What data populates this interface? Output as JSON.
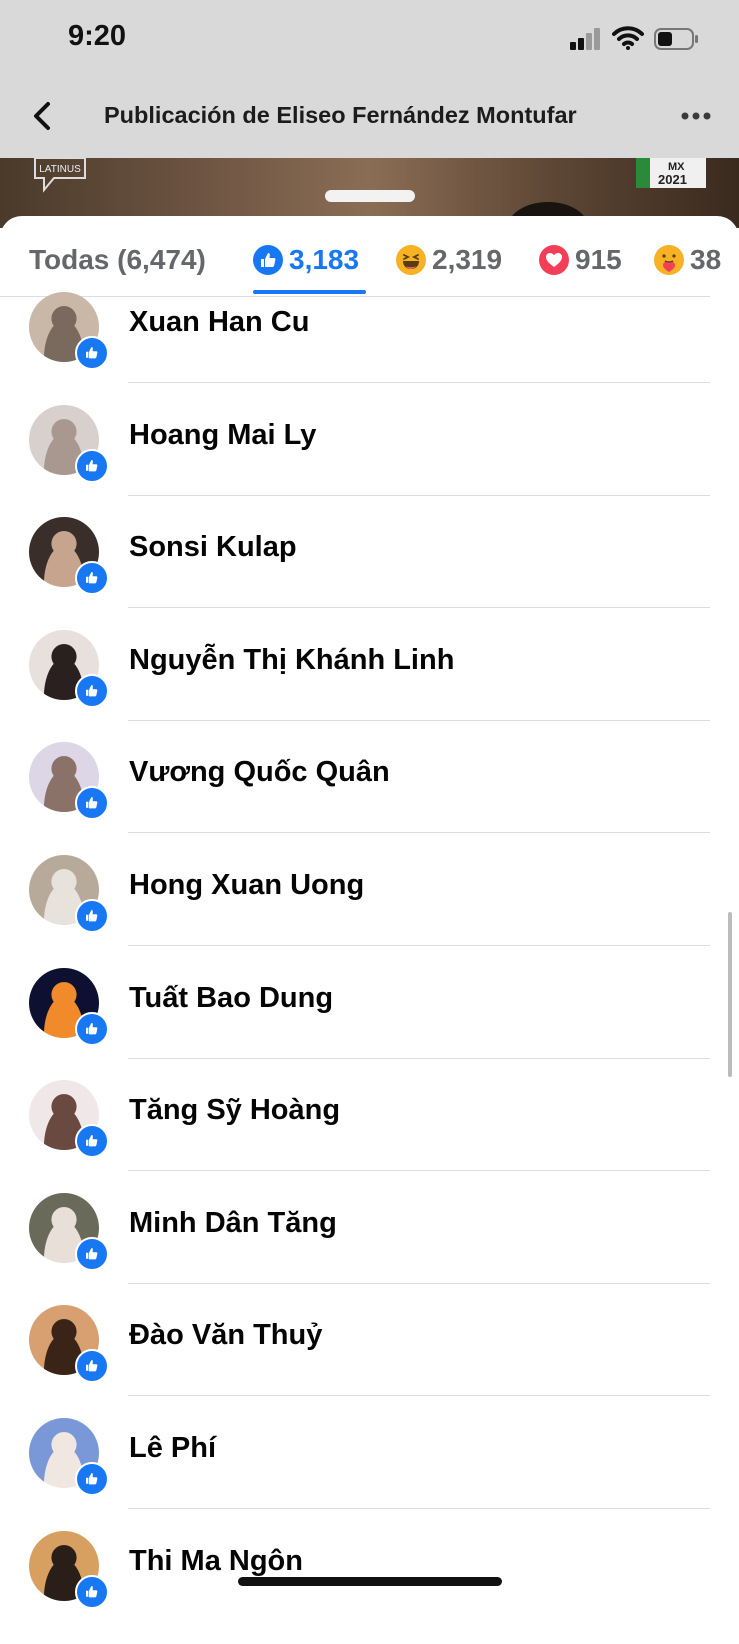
{
  "status_bar": {
    "time": "9:20",
    "icons": [
      "cellular-signal-icon",
      "wifi-icon",
      "battery-icon"
    ]
  },
  "header": {
    "back_icon": "chevron-left-icon",
    "title": "Publicación de Eliseo Fernández Montufar",
    "more_icon": "ellipsis-icon"
  },
  "backdrop": {
    "badge_left": "LATINUS",
    "badge_right_line1": "MX",
    "badge_right_line2": "2021"
  },
  "tabs": [
    {
      "label": "Todas (6,474)",
      "icon": ""
    },
    {
      "label": "3,183",
      "icon": "like-icon"
    },
    {
      "label": "2,319",
      "icon": "haha-icon"
    },
    {
      "label": "915",
      "icon": "love-icon"
    },
    {
      "label": "38",
      "icon": "care-icon"
    }
  ],
  "active_tab_index": 1,
  "colors": {
    "accent": "#1877f2",
    "header_bg": "#d9d9d9",
    "text": "#050505",
    "muted": "#65676b"
  },
  "people": [
    {
      "name": "Xuan Han Cu",
      "reaction": "like-icon"
    },
    {
      "name": "Hoang Mai Ly",
      "reaction": "like-icon"
    },
    {
      "name": "Sonsi Kulap",
      "reaction": "like-icon"
    },
    {
      "name": "Nguyễn Thị Khánh Linh",
      "reaction": "like-icon"
    },
    {
      "name": "Vương Quốc Quân",
      "reaction": "like-icon"
    },
    {
      "name": "Hong Xuan Uong",
      "reaction": "like-icon"
    },
    {
      "name": "Tuất Bao Dung",
      "reaction": "like-icon"
    },
    {
      "name": "Tăng Sỹ Hoàng",
      "reaction": "like-icon"
    },
    {
      "name": "Minh Dân Tăng",
      "reaction": "like-icon"
    },
    {
      "name": "Đào Văn Thuỷ",
      "reaction": "like-icon"
    },
    {
      "name": "Lê Phí",
      "reaction": "like-icon"
    },
    {
      "name": "Thi Ma Ngôn",
      "reaction": "like-icon"
    }
  ]
}
